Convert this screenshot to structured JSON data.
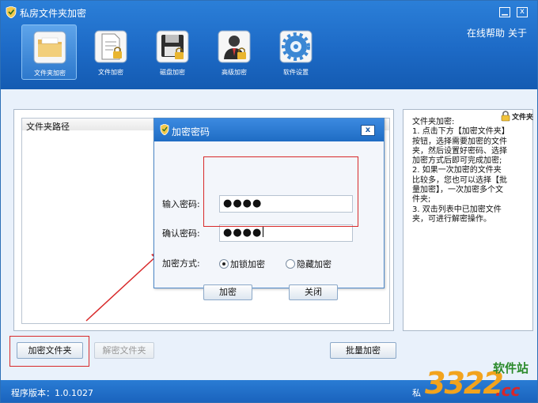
{
  "app": {
    "title": "私房文件夹加密",
    "help_link": "在线帮助",
    "about_link": "关于",
    "minimize": "▁",
    "close": "x"
  },
  "toolbar": {
    "items": [
      {
        "label": "文件夹加密",
        "icon": "folder-icon",
        "active": true
      },
      {
        "label": "文件加密",
        "icon": "document-lock-icon",
        "active": false
      },
      {
        "label": "磁盘加密",
        "icon": "floppy-disk-lock-icon",
        "active": false
      },
      {
        "label": "高级加密",
        "icon": "user-icon",
        "active": false
      },
      {
        "label": "软件设置",
        "icon": "gear-icon",
        "active": false
      }
    ]
  },
  "folder_list": {
    "column_header": "文件夹路径",
    "rows": []
  },
  "help_panel": {
    "badge": "文件夹",
    "text": "文件夹加密:\n1. 点击下方【加密文件夹】按钮，选择需要加密的文件夹，然后设置好密码、选择加密方式后即可完成加密;\n2. 如果一次加密的文件夹比较多，您也可以选择【批量加密】，一次加密多个文件夹;\n3. 双击列表中已加密文件夹，可进行解密操作。"
  },
  "buttons": {
    "encrypt_folder": "加密文件夹",
    "decrypt_folder": "解密文件夹",
    "batch_encrypt": "批量加密"
  },
  "status_bar": {
    "version_label": "程序版本：1.0.1027",
    "right_text": "私"
  },
  "dialog": {
    "title": "加密密码",
    "close": "x",
    "password_label": "输入密码:",
    "password_value": "●●●●",
    "confirm_label": "确认密码:",
    "confirm_value": "●●●●",
    "method_label": "加密方式:",
    "methods": [
      {
        "label": "加锁加密",
        "selected": true
      },
      {
        "label": "隐藏加密",
        "selected": false
      }
    ],
    "encrypt_button": "加密",
    "close_button": "关闭"
  },
  "watermark": {
    "digits": "3322",
    "site": "软件站",
    "domain": ".cc"
  },
  "colors": {
    "header_blue": "#1d6ac6",
    "highlight_red": "#d8292a"
  }
}
